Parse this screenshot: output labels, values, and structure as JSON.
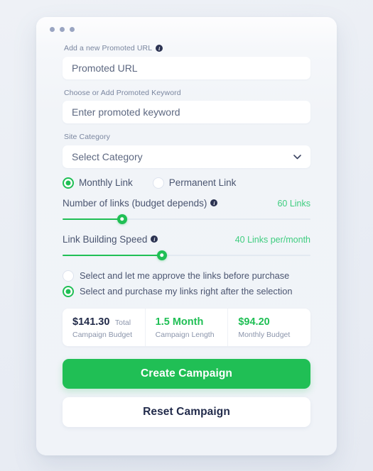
{
  "window": {
    "dots": [
      "dot-1",
      "dot-2",
      "dot-3"
    ]
  },
  "form": {
    "promoted_url": {
      "label": "Add a new Promoted URL",
      "info_glyph": "i",
      "placeholder": "Promoted URL",
      "value": ""
    },
    "promoted_keyword": {
      "label": "Choose or Add Promoted Keyword",
      "placeholder": "Enter promoted keyword",
      "value": ""
    },
    "site_category": {
      "label": "Site Category",
      "selected": "Select Category",
      "options": [
        "Select Category"
      ],
      "chevron_icon": "chevron-down-icon"
    },
    "link_type": {
      "options": [
        {
          "label": "Monthly Link",
          "selected": true
        },
        {
          "label": "Permanent Link",
          "selected": false
        }
      ]
    },
    "number_of_links": {
      "label": "Number of links (budget depends)",
      "info_glyph": "i",
      "value_text": "60 Links",
      "percent": 24
    },
    "link_building_speed": {
      "label": "Link Building Speed",
      "info_glyph": "i",
      "value_text": "40 Links per/month",
      "percent": 40
    },
    "purchase_mode": {
      "options": [
        {
          "label": "Select and let me approve the links before purchase",
          "selected": false
        },
        {
          "label": "Select and purchase my links right after the selection",
          "selected": true
        }
      ]
    }
  },
  "summary": {
    "cells": [
      {
        "amount": "$141.30",
        "unit": "Total",
        "caption": "Campaign Budget",
        "green": false
      },
      {
        "amount": "1.5 Month",
        "unit": "",
        "caption": "Campaign Length",
        "green": true
      },
      {
        "amount": "$94.20",
        "unit": "",
        "caption": "Monthly Budget",
        "green": true
      }
    ]
  },
  "actions": {
    "create_label": "Create Campaign",
    "reset_label": "Reset Campaign"
  },
  "colors": {
    "accent_green": "#20bf55",
    "value_green": "#3ecd7f",
    "text_dark": "#222b49",
    "text_muted": "#8b95ab",
    "page_bg": "#eef1f6"
  }
}
